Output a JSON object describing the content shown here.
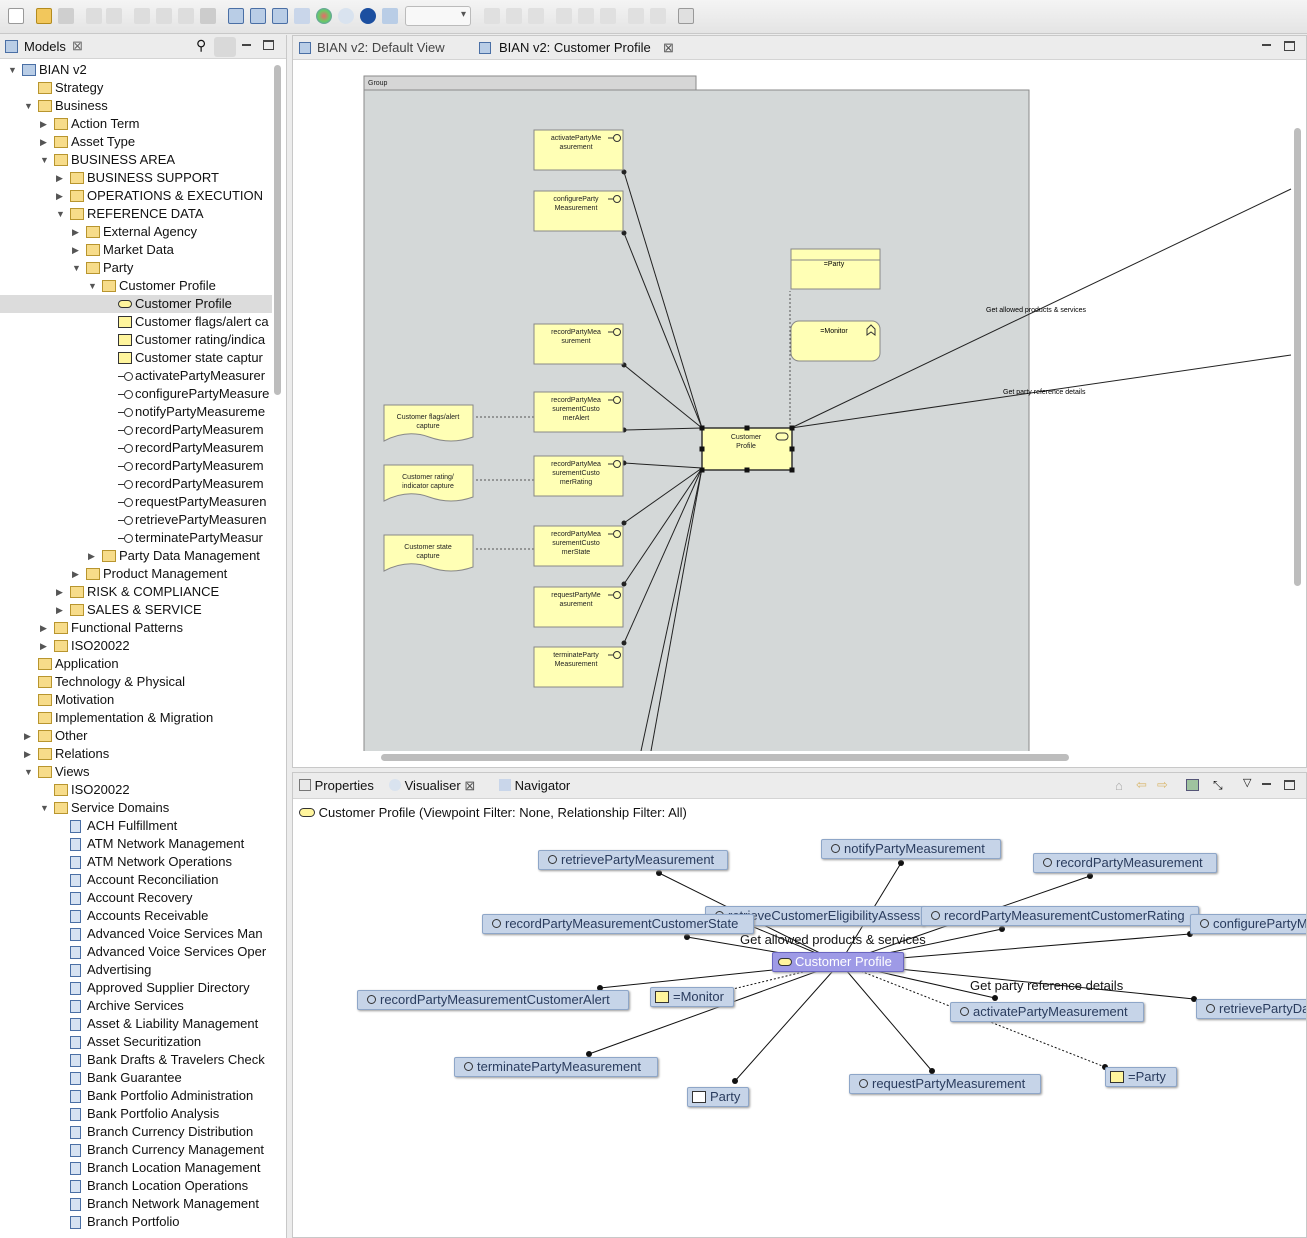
{
  "models_panel": {
    "title": "Models",
    "tree": [
      {
        "label": "BIAN v2",
        "depth": 0,
        "twisty": "open",
        "icon": "model"
      },
      {
        "label": "Strategy",
        "depth": 1,
        "twisty": "none",
        "icon": "folder"
      },
      {
        "label": "Business",
        "depth": 1,
        "twisty": "open",
        "icon": "folder"
      },
      {
        "label": "Action Term",
        "depth": 2,
        "twisty": "closed",
        "icon": "folder"
      },
      {
        "label": "Asset Type",
        "depth": 2,
        "twisty": "closed",
        "icon": "folder"
      },
      {
        "label": "BUSINESS AREA",
        "depth": 2,
        "twisty": "open",
        "icon": "folder"
      },
      {
        "label": "BUSINESS SUPPORT",
        "depth": 3,
        "twisty": "closed",
        "icon": "folder"
      },
      {
        "label": "OPERATIONS & EXECUTION",
        "depth": 3,
        "twisty": "closed",
        "icon": "folder"
      },
      {
        "label": "REFERENCE DATA",
        "depth": 3,
        "twisty": "open",
        "icon": "folder"
      },
      {
        "label": "External Agency",
        "depth": 4,
        "twisty": "closed",
        "icon": "folder"
      },
      {
        "label": "Market Data",
        "depth": 4,
        "twisty": "closed",
        "icon": "folder"
      },
      {
        "label": "Party",
        "depth": 4,
        "twisty": "open",
        "icon": "folder"
      },
      {
        "label": "Customer Profile",
        "depth": 5,
        "twisty": "open",
        "icon": "folder"
      },
      {
        "label": "Customer Profile",
        "depth": 6,
        "twisty": "none",
        "icon": "service",
        "selected": true
      },
      {
        "label": "Customer flags/alert ca",
        "depth": 6,
        "twisty": "none",
        "icon": "object"
      },
      {
        "label": "Customer rating/indica",
        "depth": 6,
        "twisty": "none",
        "icon": "object"
      },
      {
        "label": "Customer state captur",
        "depth": 6,
        "twisty": "none",
        "icon": "object"
      },
      {
        "label": "activatePartyMeasurer",
        "depth": 6,
        "twisty": "none",
        "icon": "interface"
      },
      {
        "label": "configurePartyMeasure",
        "depth": 6,
        "twisty": "none",
        "icon": "interface"
      },
      {
        "label": "notifyPartyMeasureme",
        "depth": 6,
        "twisty": "none",
        "icon": "interface"
      },
      {
        "label": "recordPartyMeasurem",
        "depth": 6,
        "twisty": "none",
        "icon": "interface"
      },
      {
        "label": "recordPartyMeasurem",
        "depth": 6,
        "twisty": "none",
        "icon": "interface"
      },
      {
        "label": "recordPartyMeasurem",
        "depth": 6,
        "twisty": "none",
        "icon": "interface"
      },
      {
        "label": "recordPartyMeasurem",
        "depth": 6,
        "twisty": "none",
        "icon": "interface"
      },
      {
        "label": "requestPartyMeasuren",
        "depth": 6,
        "twisty": "none",
        "icon": "interface"
      },
      {
        "label": "retrievePartyMeasuren",
        "depth": 6,
        "twisty": "none",
        "icon": "interface"
      },
      {
        "label": "terminatePartyMeasur",
        "depth": 6,
        "twisty": "none",
        "icon": "interface"
      },
      {
        "label": "Party Data Management",
        "depth": 5,
        "twisty": "closed",
        "icon": "folder"
      },
      {
        "label": "Product Management",
        "depth": 4,
        "twisty": "closed",
        "icon": "folder"
      },
      {
        "label": "RISK & COMPLIANCE",
        "depth": 3,
        "twisty": "closed",
        "icon": "folder"
      },
      {
        "label": "SALES & SERVICE",
        "depth": 3,
        "twisty": "closed",
        "icon": "folder"
      },
      {
        "label": "Functional Patterns",
        "depth": 2,
        "twisty": "closed",
        "icon": "folder"
      },
      {
        "label": "ISO20022",
        "depth": 2,
        "twisty": "closed",
        "icon": "folder"
      },
      {
        "label": "Application",
        "depth": 1,
        "twisty": "none",
        "icon": "folder"
      },
      {
        "label": "Technology & Physical",
        "depth": 1,
        "twisty": "none",
        "icon": "folder"
      },
      {
        "label": "Motivation",
        "depth": 1,
        "twisty": "none",
        "icon": "folder"
      },
      {
        "label": "Implementation & Migration",
        "depth": 1,
        "twisty": "none",
        "icon": "folder"
      },
      {
        "label": "Other",
        "depth": 1,
        "twisty": "closed",
        "icon": "folder"
      },
      {
        "label": "Relations",
        "depth": 1,
        "twisty": "closed",
        "icon": "folder"
      },
      {
        "label": "Views",
        "depth": 1,
        "twisty": "open",
        "icon": "folder"
      },
      {
        "label": "ISO20022",
        "depth": 2,
        "twisty": "none",
        "icon": "folder"
      },
      {
        "label": "Service Domains",
        "depth": 2,
        "twisty": "open",
        "icon": "folder"
      },
      {
        "label": "ACH Fulfillment",
        "depth": 3,
        "twisty": "none",
        "icon": "view"
      },
      {
        "label": "ATM Network Management",
        "depth": 3,
        "twisty": "none",
        "icon": "view"
      },
      {
        "label": "ATM Network Operations",
        "depth": 3,
        "twisty": "none",
        "icon": "view"
      },
      {
        "label": "Account Reconciliation",
        "depth": 3,
        "twisty": "none",
        "icon": "view"
      },
      {
        "label": "Account Recovery",
        "depth": 3,
        "twisty": "none",
        "icon": "view"
      },
      {
        "label": "Accounts Receivable",
        "depth": 3,
        "twisty": "none",
        "icon": "view"
      },
      {
        "label": "Advanced Voice Services  Man",
        "depth": 3,
        "twisty": "none",
        "icon": "view"
      },
      {
        "label": "Advanced Voice Services Oper",
        "depth": 3,
        "twisty": "none",
        "icon": "view"
      },
      {
        "label": "Advertising",
        "depth": 3,
        "twisty": "none",
        "icon": "view"
      },
      {
        "label": "Approved Supplier Directory",
        "depth": 3,
        "twisty": "none",
        "icon": "view"
      },
      {
        "label": "Archive Services",
        "depth": 3,
        "twisty": "none",
        "icon": "view"
      },
      {
        "label": "Asset & Liability Management",
        "depth": 3,
        "twisty": "none",
        "icon": "view"
      },
      {
        "label": "Asset Securitization",
        "depth": 3,
        "twisty": "none",
        "icon": "view"
      },
      {
        "label": "Bank Drafts & Travelers Check",
        "depth": 3,
        "twisty": "none",
        "icon": "view"
      },
      {
        "label": "Bank Guarantee",
        "depth": 3,
        "twisty": "none",
        "icon": "view"
      },
      {
        "label": "Bank Portfolio Administration",
        "depth": 3,
        "twisty": "none",
        "icon": "view"
      },
      {
        "label": "Bank Portfolio Analysis",
        "depth": 3,
        "twisty": "none",
        "icon": "view"
      },
      {
        "label": "Branch Currency Distribution",
        "depth": 3,
        "twisty": "none",
        "icon": "view"
      },
      {
        "label": "Branch Currency Management",
        "depth": 3,
        "twisty": "none",
        "icon": "view"
      },
      {
        "label": "Branch Location Management",
        "depth": 3,
        "twisty": "none",
        "icon": "view"
      },
      {
        "label": "Branch Location Operations",
        "depth": 3,
        "twisty": "none",
        "icon": "view"
      },
      {
        "label": "Branch Network  Management",
        "depth": 3,
        "twisty": "none",
        "icon": "view"
      },
      {
        "label": "Branch Portfolio",
        "depth": 3,
        "twisty": "none",
        "icon": "view"
      }
    ]
  },
  "editor": {
    "tabs": [
      {
        "label": "BIAN v2: Default View",
        "active": false
      },
      {
        "label": "BIAN v2: Customer Profile",
        "active": true
      }
    ],
    "group_label": "Group",
    "interfaces": [
      [
        "activatePartyMe",
        "asurement"
      ],
      [
        "configureParty",
        "Measurement"
      ],
      [
        "recordPartyMea",
        "surement"
      ],
      [
        "recordPartyMea",
        "surementCusto",
        "merAlert"
      ],
      [
        "recordPartyMea",
        "surementCusto",
        "merRating"
      ],
      [
        "recordPartyMea",
        "surementCusto",
        "merState"
      ],
      [
        "requestPartyMe",
        "asurement"
      ],
      [
        "terminateParty",
        "Measurement"
      ]
    ],
    "objects": [
      [
        "Customer flags/alert",
        "capture"
      ],
      [
        "Customer rating/",
        "indicator capture"
      ],
      [
        "Customer state",
        "capture"
      ]
    ],
    "party_label": "=Party",
    "monitor_label": "=Monitor",
    "service_label": [
      "Customer",
      "Profile"
    ],
    "edge_labels": [
      "Get allowed products & services",
      "Get party reference details"
    ]
  },
  "bottom_panel": {
    "tabs": [
      "Properties",
      "Visualiser",
      "Navigator"
    ],
    "header": "Customer Profile (Viewpoint Filter: None, Relationship Filter: All)",
    "center_node": "Customer Profile",
    "nodes": [
      {
        "label": "retrievePartyMeasurement",
        "icon": "interface"
      },
      {
        "label": "notifyPartyMeasurement",
        "icon": "interface"
      },
      {
        "label": "recordPartyMeasurement",
        "icon": "interface"
      },
      {
        "label": "retrieveCustomerEligibilityAssessment",
        "icon": "interface"
      },
      {
        "label": "recordPartyMeasurementCustomerRating",
        "icon": "interface"
      },
      {
        "label": "recordPartyMeasurementCustomerState",
        "icon": "interface"
      },
      {
        "label": "configurePartyMeasurement",
        "icon": "interface"
      },
      {
        "label": "recordPartyMeasurementCustomerAlert",
        "icon": "interface"
      },
      {
        "label": "=Monitor",
        "icon": "function"
      },
      {
        "label": "activatePartyMeasurement",
        "icon": "interface"
      },
      {
        "label": "retrievePartyDataManagement",
        "icon": "interface"
      },
      {
        "label": "terminatePartyMeasurement",
        "icon": "interface"
      },
      {
        "label": "requestPartyMeasurement",
        "icon": "interface"
      },
      {
        "label": "=Party",
        "icon": "object"
      },
      {
        "label": "Party",
        "icon": "folder"
      }
    ],
    "edge_labels": [
      "Get allowed products & services",
      "Get party reference details"
    ]
  },
  "toolbar": {
    "zoom_value": ""
  }
}
